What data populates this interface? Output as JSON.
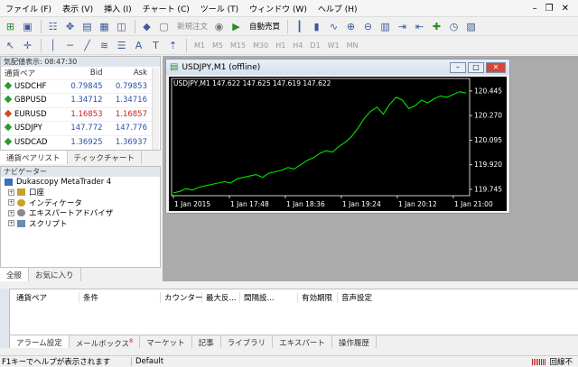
{
  "menubar": {
    "items": [
      "ファイル (F)",
      "表示 (V)",
      "挿入 (I)",
      "チャート (C)",
      "ツール (T)",
      "ウィンドウ (W)",
      "ヘルプ (H)"
    ]
  },
  "toolbar": {
    "new_order": "新規注文",
    "auto_trading": "自動売買",
    "timeframes": [
      "M1",
      "M5",
      "M15",
      "M30",
      "H1",
      "H4",
      "D1",
      "W1",
      "MN"
    ]
  },
  "market_watch": {
    "title": "気配値表示: 08:47:30",
    "col_symbol": "通貨ペア",
    "col_bid": "Bid",
    "col_ask": "Ask",
    "rows": [
      {
        "symbol": "USDCHF",
        "bid": "0.79845",
        "ask": "0.79853",
        "color": "blue"
      },
      {
        "symbol": "GBPUSD",
        "bid": "1.34712",
        "ask": "1.34716",
        "color": "blue"
      },
      {
        "symbol": "EURUSD",
        "bid": "1.16853",
        "ask": "1.16857",
        "color": "red"
      },
      {
        "symbol": "USDJPY",
        "bid": "147.772",
        "ask": "147.776",
        "color": "blue"
      },
      {
        "symbol": "USDCAD",
        "bid": "1.36925",
        "ask": "1.36937",
        "color": "blue"
      }
    ],
    "tabs": [
      "通貨ペアリスト",
      "ティックチャート"
    ]
  },
  "navigator": {
    "title": "ナビゲーター",
    "root": "Dukascopy MetaTrader 4",
    "items": [
      "口座",
      "インディケータ",
      "エキスパートアドバイザ",
      "スクリプト"
    ],
    "tabs": [
      "全般",
      "お気に入り"
    ]
  },
  "chart_window": {
    "title": "USDJPY,M1 (offline)",
    "header": "USDJPY,M1  147.622 147.625 147.619 147.622"
  },
  "chart_data": {
    "type": "line",
    "title": "",
    "xlabel": "",
    "ylabel": "",
    "x_ticks": [
      "1 Jan 2015",
      "1 Jan 17:48",
      "1 Jan 18:36",
      "1 Jan 19:24",
      "1 Jan 20:12",
      "1 Jan 21:00"
    ],
    "y_ticks": [
      120.445,
      120.27,
      120.095,
      119.92,
      119.745
    ],
    "ylim": [
      119.7,
      120.47
    ],
    "series": [
      {
        "values": [
          119.72,
          119.73,
          119.75,
          119.74,
          119.76,
          119.77,
          119.78,
          119.79,
          119.8,
          119.79,
          119.82,
          119.83,
          119.84,
          119.85,
          119.83,
          119.86,
          119.87,
          119.88,
          119.9,
          119.89,
          119.92,
          119.95,
          119.97,
          120.0,
          120.02,
          120.01,
          120.05,
          120.08,
          120.12,
          120.18,
          120.25,
          120.3,
          120.33,
          120.28,
          120.35,
          120.4,
          120.38,
          120.32,
          120.34,
          120.38,
          120.36,
          120.39,
          120.41,
          120.4,
          120.42,
          120.44,
          120.43
        ]
      }
    ],
    "color": "#00e600",
    "background": "#000000",
    "axis_color": "#ffffff"
  },
  "terminal": {
    "columns": [
      "通貨ペア",
      "条件",
      "カウンター",
      "最大反...",
      "間隔設...",
      "有効期限",
      "音声設定"
    ],
    "tabs": [
      "アラーム設定",
      "メールボックス",
      "マーケット",
      "記事",
      "ライブラリ",
      "エキスパート",
      "操作履歴"
    ],
    "mail_badge": "8"
  },
  "status": {
    "help": "F1キーでヘルプが表示されます",
    "profile": "Default",
    "connection": "回線不"
  }
}
